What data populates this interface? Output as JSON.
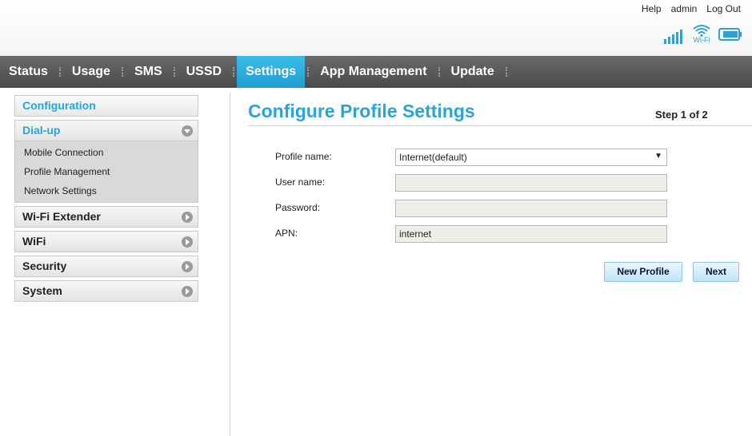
{
  "header": {
    "links": {
      "help": "Help",
      "admin": "admin",
      "logout": "Log Out"
    },
    "wifi_label": "Wi-Fi",
    "signal_icon": "signal-bars-icon",
    "battery_icon": "battery-icon"
  },
  "nav": {
    "items": [
      {
        "label": "Status"
      },
      {
        "label": "Usage"
      },
      {
        "label": "SMS"
      },
      {
        "label": "USSD"
      },
      {
        "label": "Settings",
        "active": true
      },
      {
        "label": "App Management"
      },
      {
        "label": "Update"
      }
    ]
  },
  "sidebar": {
    "heading": "Configuration",
    "groups": [
      {
        "label": "Dial-up",
        "expanded": true,
        "items": [
          "Mobile Connection",
          "Profile Management",
          "Network Settings"
        ]
      },
      {
        "label": "Wi-Fi Extender"
      },
      {
        "label": "WiFi"
      },
      {
        "label": "Security"
      },
      {
        "label": "System"
      }
    ]
  },
  "main": {
    "title": "Configure Profile Settings",
    "step": "Step 1 of 2",
    "form": {
      "profile_name_label": "Profile name:",
      "profile_name_value": "Internet(default)",
      "user_name_label": "User name:",
      "user_name_value": "",
      "password_label": "Password:",
      "password_value": "",
      "apn_label": "APN:",
      "apn_value": "internet"
    },
    "buttons": {
      "new_profile": "New Profile",
      "next": "Next"
    }
  },
  "colors": {
    "accent": "#2aa4d6",
    "nav_bg": "#555555",
    "nav_active": "#2aaee0"
  }
}
